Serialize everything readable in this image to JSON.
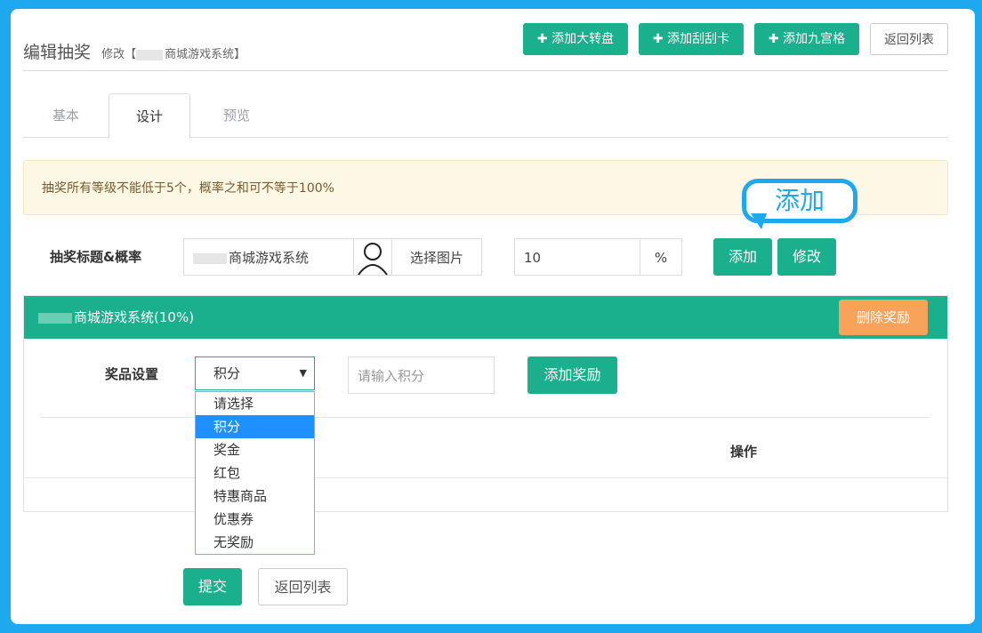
{
  "header": {
    "title": "编辑抽奖",
    "subtitle": "修改【",
    "subtitle_name": "商城游戏系统】",
    "buttons": {
      "add_wheel": "✚ 添加大转盘",
      "add_scratch": "✚ 添加刮刮卡",
      "add_grid": "✚ 添加九宫格",
      "back": "返回列表"
    }
  },
  "tabs": [
    "基本",
    "设计",
    "预览"
  ],
  "alert": "抽奖所有等级不能低于5个，概率之和可不等于100%",
  "callout": "添加",
  "form": {
    "label": "抽奖标题&概率",
    "title_value": "商城游戏系统",
    "choose_image": "选择图片",
    "probability_value": "10",
    "percent": "%",
    "add_button": "添加",
    "edit_button": "修改"
  },
  "prize": {
    "header_title": "商城游戏系统(10%)",
    "delete_button": "删除奖励",
    "setting_label": "奖品设置",
    "select_value": "积分",
    "input_placeholder": "请输入积分",
    "add_reward_button": "添加奖励",
    "operation_header": "操作",
    "options": [
      "请选择",
      "积分",
      "奖金",
      "红包",
      "特惠商品",
      "优惠券",
      "无奖励"
    ],
    "selected_index": 1
  },
  "footer": {
    "submit": "提交",
    "back": "返回列表"
  }
}
